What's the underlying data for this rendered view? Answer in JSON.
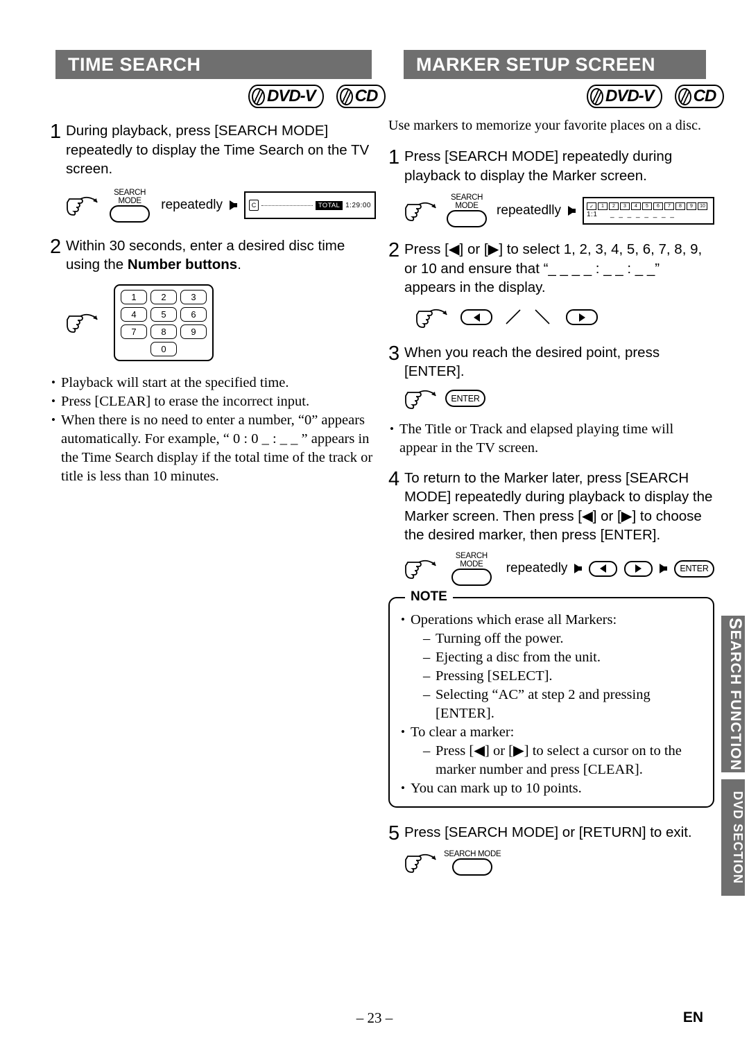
{
  "headers": {
    "left": "TIME SEARCH",
    "right": "MARKER SETUP SCREEN"
  },
  "logos": {
    "dvd": "DVD-V",
    "cd": "CD"
  },
  "left_column": {
    "step1_num": "1",
    "step1_text": "During playback, press [SEARCH MODE] repeatedly to display the Time Search on the TV screen.",
    "step1_key_label": "SEARCH MODE",
    "step1_repeatedly": "repeatedly",
    "tv_display": {
      "icon": "C",
      "total_badge": "TOTAL",
      "time": "1:29:00"
    },
    "step2_num": "2",
    "step2_text_a": "Within 30 seconds, enter a desired disc time using the ",
    "step2_text_b": "Number buttons",
    "step2_text_c": ".",
    "keypad": [
      "1",
      "2",
      "3",
      "4",
      "5",
      "6",
      "7",
      "8",
      "9",
      "0"
    ],
    "bullets": [
      "Playback will start at the specified time.",
      "Press [CLEAR] to erase the incorrect input.",
      "When there is no need to enter a number, “0” appears automatically. For example, “ 0 : 0 _ : _ _ ” appears in the Time Search display if the total time of the track or title is less than 10 minutes."
    ]
  },
  "right_column": {
    "intro": "Use markers to memorize your favorite places on a disc.",
    "step1_num": "1",
    "step1_text": "Press [SEARCH MODE] repeatedly during playback to display the Marker screen.",
    "step1_key_label": "SEARCH MODE",
    "step1_repeatedly": "repeatedlly",
    "marker_display": {
      "row1_left": "✓",
      "row2_left": "1:1",
      "cells": [
        "1",
        "2",
        "3",
        "4",
        "5",
        "6",
        "7",
        "8",
        "9",
        "10"
      ]
    },
    "step2_num": "2",
    "step2_text": "Press [◀] or [▶] to select 1, 2, 3, 4, 5, 6, 7, 8, 9, or 10 and ensure that “_ _  _ _ : _ _ : _ _” appears in the display.",
    "step3_num": "3",
    "step3_text": "When you reach the desired point, press [ENTER].",
    "enter_key": "ENTER",
    "step3_bullet": "The Title or Track and elapsed playing time will appear in the TV screen.",
    "step4_num": "4",
    "step4_text": "To return to the Marker later, press [SEARCH MODE] repeatedly during playback to display the Marker screen. Then press [◀] or [▶] to choose the desired marker, then press [ENTER].",
    "step4_key_label": "SEARCH MODE",
    "step4_repeatedly": "repeatedly",
    "step4_enter": "ENTER",
    "note": {
      "title": "NOTE",
      "items": [
        {
          "text": "Operations which erase all Markers:",
          "subs": [
            "Turning off the power.",
            "Ejecting a disc from the unit.",
            "Pressing [SELECT].",
            "Selecting “AC” at step 2 and pressing [ENTER]."
          ]
        },
        {
          "text": "To clear a marker:",
          "subs": [
            "Press [◀] or [▶] to select a cursor on to the marker number and press [CLEAR]."
          ]
        },
        {
          "text": "You can mark up to 10 points.",
          "subs": []
        }
      ]
    },
    "step5_num": "5",
    "step5_text": "Press [SEARCH MODE] or [RETURN] to exit.",
    "step5_key_label": "SEARCH MODE"
  },
  "side_tabs": {
    "search_function": "EARCH FUNCTION",
    "search_function_cap": "S",
    "dvd_section": "DVD SECTION"
  },
  "footer": {
    "page": "– 23 –",
    "lang": "EN"
  },
  "colors": {
    "header_bar": "#6f6f6f",
    "text": "#000000",
    "page_bg": "#ffffff"
  }
}
